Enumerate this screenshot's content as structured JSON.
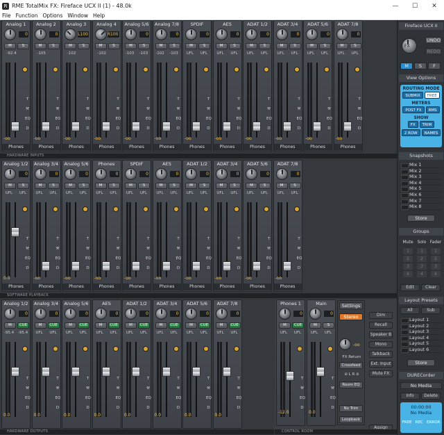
{
  "window": {
    "title": "RME TotalMix FX: Fireface UCX II (1) - 48.0k",
    "app_icon_letter": "R",
    "controls": [
      "—",
      "☐",
      "✕"
    ]
  },
  "menu": [
    "File",
    "Function",
    "Options",
    "Window",
    "Help"
  ],
  "inputs": {
    "label": "HARDWARE INPUTS",
    "strips": [
      {
        "name": "Analog 1",
        "knob": "0",
        "btn1": "M",
        "btn2": "S",
        "v1": "-92.4",
        "v2": "",
        "fader_pos": 0.1,
        "knob_dir": "c"
      },
      {
        "name": "Analog 2",
        "knob": "0",
        "btn1": "M",
        "btn2": "S",
        "v1": "-105",
        "v2": "",
        "fader_pos": 0.1,
        "knob_dir": "c"
      },
      {
        "name": "Analog 3",
        "knob": "L100",
        "btn1": "M",
        "btn2": "S",
        "v1": "-102",
        "v2": "",
        "fader_pos": 0.1,
        "knob_dir": "l"
      },
      {
        "name": "Analog 4",
        "knob": "R100",
        "btn1": "M",
        "btn2": "S",
        "v1": "-102",
        "v2": "",
        "fader_pos": 0.1,
        "knob_dir": "r"
      },
      {
        "name": "Analog 5/6",
        "knob": "0",
        "btn1": "M",
        "btn2": "S",
        "v1": "-103",
        "v2": "-103",
        "fader_pos": 0.1,
        "knob_dir": "c"
      },
      {
        "name": "Analog 7/8",
        "knob": "0",
        "btn1": "M",
        "btn2": "S",
        "v1": "-102",
        "v2": "-103",
        "fader_pos": 0.1,
        "knob_dir": "c"
      },
      {
        "name": "SPDIF",
        "knob": "0",
        "btn1": "M",
        "btn2": "S",
        "v1": "UFL",
        "v2": "UFL",
        "fader_pos": 0.1,
        "knob_dir": "c"
      },
      {
        "name": "AES",
        "knob": "0",
        "btn1": "M",
        "btn2": "S",
        "v1": "UFL",
        "v2": "UFL",
        "fader_pos": 0.1,
        "knob_dir": "c"
      },
      {
        "name": "ADAT 1/2",
        "knob": "0",
        "btn1": "M",
        "btn2": "S",
        "v1": "UFL",
        "v2": "UFL",
        "fader_pos": 0.1,
        "knob_dir": "c"
      },
      {
        "name": "ADAT 3/4",
        "knob": "0",
        "btn1": "M",
        "btn2": "S",
        "v1": "UFL",
        "v2": "UFL",
        "fader_pos": 0.1,
        "knob_dir": "c"
      },
      {
        "name": "ADAT 5/6",
        "knob": "0",
        "btn1": "M",
        "btn2": "S",
        "v1": "UFL",
        "v2": "UFL",
        "fader_pos": 0.1,
        "knob_dir": "c"
      },
      {
        "name": "ADAT 7/8",
        "knob": "0",
        "btn1": "M",
        "btn2": "S",
        "v1": "UFL",
        "v2": "UFL",
        "fader_pos": 0.1,
        "knob_dir": "c"
      }
    ],
    "level": "-oo",
    "route": "Phones"
  },
  "playback": {
    "label": "SOFTWARE PLAYBACK",
    "strips": [
      {
        "name": "Analog 1/2",
        "knob": "0",
        "btn1": "M",
        "btn2": "S",
        "v1": "UFL",
        "v2": "UFL",
        "level": "0.0",
        "fader_pos": 0.62,
        "knob_dir": "c"
      },
      {
        "name": "Analog 3/4",
        "knob": "0",
        "btn1": "M",
        "btn2": "S",
        "v1": "UFL",
        "v2": "UFL",
        "level": "-oo",
        "fader_pos": 0.1,
        "knob_dir": "c"
      },
      {
        "name": "Analog 5/6",
        "knob": "0",
        "btn1": "M",
        "btn2": "S",
        "v1": "UFL",
        "v2": "UFL",
        "level": "-oo",
        "fader_pos": 0.1,
        "knob_dir": "c"
      },
      {
        "name": "Phones",
        "knob": "0",
        "btn1": "M",
        "btn2": "S",
        "v1": "UFL",
        "v2": "UFL",
        "level": "-oo",
        "fader_pos": 0.1,
        "knob_dir": "c"
      },
      {
        "name": "SPDIF",
        "knob": "0",
        "btn1": "M",
        "btn2": "S",
        "v1": "UFL",
        "v2": "UFL",
        "level": "-oo",
        "fader_pos": 0.1,
        "knob_dir": "c"
      },
      {
        "name": "AES",
        "knob": "0",
        "btn1": "M",
        "btn2": "S",
        "v1": "UFL",
        "v2": "UFL",
        "level": "-oo",
        "fader_pos": 0.1,
        "knob_dir": "c"
      },
      {
        "name": "ADAT 1/2",
        "knob": "0",
        "btn1": "M",
        "btn2": "S",
        "v1": "UFL",
        "v2": "UFL",
        "level": "-oo",
        "fader_pos": 0.1,
        "knob_dir": "c"
      },
      {
        "name": "ADAT 3/4",
        "knob": "0",
        "btn1": "M",
        "btn2": "S",
        "v1": "UFL",
        "v2": "UFL",
        "level": "-oo",
        "fader_pos": 0.1,
        "knob_dir": "c"
      },
      {
        "name": "ADAT 5/6",
        "knob": "0",
        "btn1": "M",
        "btn2": "S",
        "v1": "UFL",
        "v2": "UFL",
        "level": "-oo",
        "fader_pos": 0.1,
        "knob_dir": "c"
      },
      {
        "name": "ADAT 7/8",
        "knob": "0",
        "btn1": "M",
        "btn2": "S",
        "v1": "UFL",
        "v2": "UFL",
        "level": "-oo",
        "fader_pos": 0.1,
        "knob_dir": "c"
      }
    ],
    "route": "Phones"
  },
  "outputs": {
    "label": "HARDWARE OUTPUTS",
    "strips": [
      {
        "name": "Analog 1/2",
        "knob": "0",
        "btn1": "M",
        "btn2": "CUE",
        "v1": "-95.4",
        "v2": "-95.4",
        "level": "0.0",
        "fader_pos": 0.62
      },
      {
        "name": "Analog 3/4",
        "knob": "0",
        "btn1": "M",
        "btn2": "CUE",
        "v1": "UFL",
        "v2": "UFL",
        "level": "0.0",
        "fader_pos": 0.62
      },
      {
        "name": "Analog 5/6",
        "knob": "0",
        "btn1": "M",
        "btn2": "CUE",
        "v1": "UFL",
        "v2": "UFL",
        "level": "0.0",
        "fader_pos": 0.62
      },
      {
        "name": "AES",
        "knob": "0",
        "btn1": "M",
        "btn2": "CUE",
        "v1": "UFL",
        "v2": "UFL",
        "level": "0.0",
        "fader_pos": 0.62
      },
      {
        "name": "ADAT 1/2",
        "knob": "0",
        "btn1": "M",
        "btn2": "CUE",
        "v1": "UFL",
        "v2": "UFL",
        "level": "0.0",
        "fader_pos": 0.62
      },
      {
        "name": "ADAT 3/4",
        "knob": "0",
        "btn1": "M",
        "btn2": "CUE",
        "v1": "UFL",
        "v2": "UFL",
        "level": "0.0",
        "fader_pos": 0.62
      },
      {
        "name": "ADAT 5/6",
        "knob": "0",
        "btn1": "M",
        "btn2": "CUE",
        "v1": "UFL",
        "v2": "UFL",
        "level": "0.0",
        "fader_pos": 0.62
      },
      {
        "name": "ADAT 7/8",
        "knob": "0",
        "btn1": "M",
        "btn2": "CUE",
        "v1": "UFL",
        "v2": "UFL",
        "level": "0.0",
        "fader_pos": 0.62
      }
    ]
  },
  "control_room": {
    "label": "CONTROL ROOM",
    "phones": {
      "name": "Phones 1",
      "knob": "0",
      "btn1": "M",
      "btn2": "CUE",
      "v1": "UFL",
      "v2": "UFL",
      "level": "-12.0",
      "fader_pos": 0.55
    },
    "main": {
      "name": "Main",
      "knob": "0",
      "btn1": "M",
      "btn2": "S",
      "v1": "UFL",
      "v2": "UFL",
      "level": "0.0",
      "fader_pos": 0.62
    },
    "settings": "Settings",
    "stereo": "Stereo",
    "fx_return": "FX Return",
    "fx_val": "-oo",
    "crossfeed": "Crossfeed",
    "lr": "⊘ L  R ⊘",
    "room_eq": "Room EQ",
    "no_trim": "No Trim",
    "loopback": "Loopback",
    "right_btns": [
      "Dim",
      "Recall",
      "Speaker B",
      "Mono",
      "Talkback",
      "Ext. Input",
      "Mute FX"
    ],
    "assign": "Assign"
  },
  "side": {
    "device": "Fireface UCX II",
    "fx": "FX",
    "undo": "UNDO",
    "redo": "REDO",
    "msf": [
      "M",
      "S",
      "F"
    ],
    "view_options": "View Options",
    "routing_title": "ROUTING MODE",
    "routing": [
      "SUBMIX",
      "FREE"
    ],
    "meters_title": "METERS",
    "meters": [
      "POST FX",
      "RMS"
    ],
    "show_title": "SHOW",
    "show": [
      "FX",
      "TRIM",
      "2 ROW",
      "NAMES"
    ],
    "snapshots": "Snapshots",
    "mixes": [
      "Mix 1",
      "Mix 2",
      "Mix 3",
      "Mix 4",
      "Mix 5",
      "Mix 6",
      "Mix 7",
      "Mix 8"
    ],
    "store": "Store",
    "groups": "Groups",
    "group_cols": [
      "Mute",
      "Solo",
      "Fader"
    ],
    "group_nums": [
      "1",
      "2",
      "3",
      "4"
    ],
    "edit": "Edit",
    "clear": "Clear",
    "layout_presets": "Layout Presets",
    "all": "All",
    "sub": "Sub",
    "layouts": [
      "Layout 1",
      "Layout 2",
      "Layout 3",
      "Layout 4",
      "Layout 5",
      "Layout 6"
    ],
    "store2": "Store",
    "durec": "DURECorder",
    "no_media": "No Media",
    "info": "Info",
    "delete": "Delete",
    "time": "00:00:00",
    "no_media2": "No Media",
    "free": "FREE",
    "rec": "REC",
    "error": "ERROR"
  },
  "colors": {
    "accent_blue": "#4ab3e6",
    "green": "#2f9a4e",
    "yellow": "#f2c14e",
    "orange": "#e07a2a",
    "red": "#c0392b"
  }
}
